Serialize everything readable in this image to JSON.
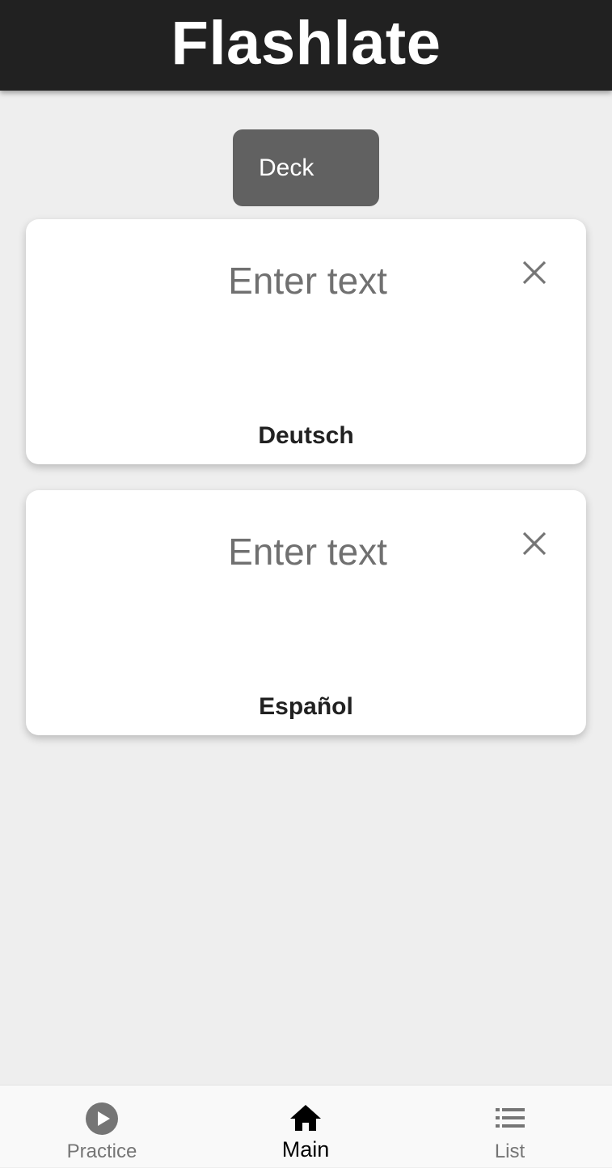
{
  "header": {
    "title": "Flashlate"
  },
  "deck_button": {
    "label": "Deck"
  },
  "cards": [
    {
      "placeholder": "Enter text",
      "value": "",
      "language": "Deutsch",
      "clear_icon": "close-icon"
    },
    {
      "placeholder": "Enter text",
      "value": "",
      "language": "Español",
      "clear_icon": "close-icon"
    }
  ],
  "bottom_nav": {
    "active": "Main",
    "items": [
      {
        "label": "Practice",
        "icon": "play-circle-icon"
      },
      {
        "label": "Main",
        "icon": "home-icon"
      },
      {
        "label": "List",
        "icon": "list-icon"
      }
    ]
  },
  "colors": {
    "header_bg": "#212121",
    "background": "#eeeeee",
    "deck_button_bg": "#616161",
    "card_bg": "#ffffff",
    "nav_active": "#000000",
    "nav_inactive": "#757575"
  }
}
